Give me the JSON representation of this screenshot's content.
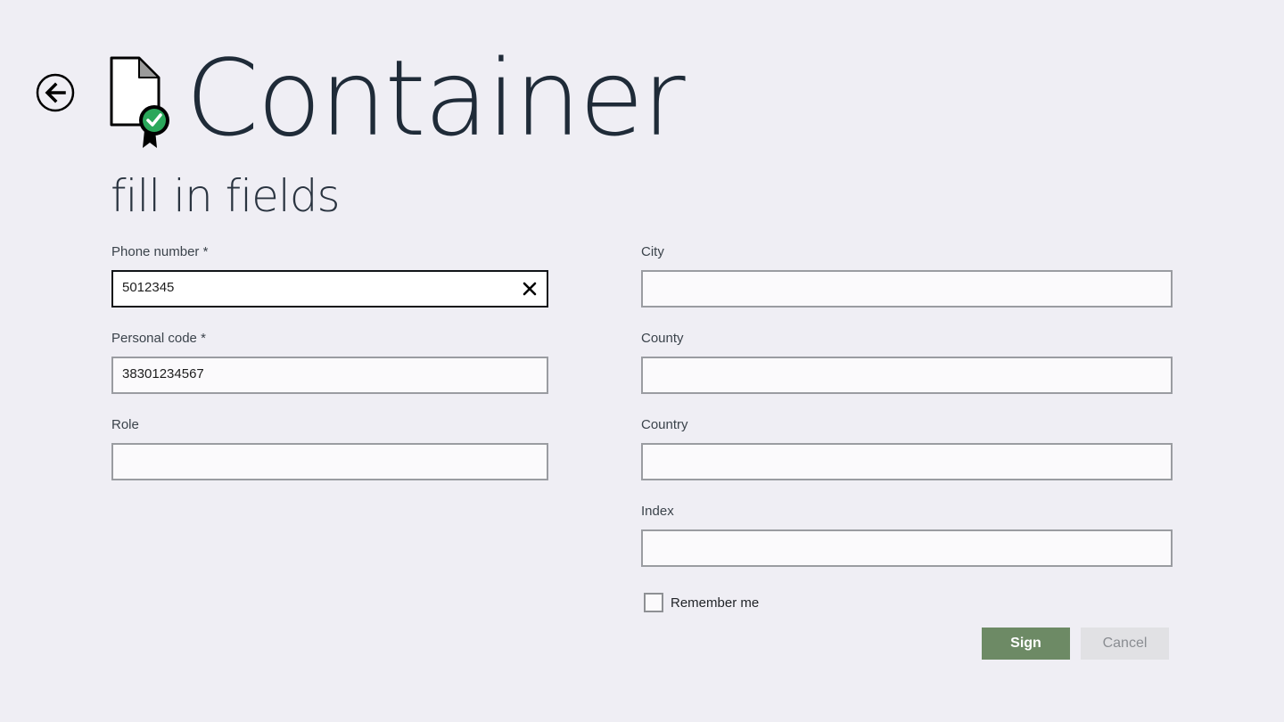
{
  "header": {
    "title": "Container",
    "subtitle": "fill in fields",
    "back_icon": "back-arrow-icon",
    "document_icon": "signed-document-icon"
  },
  "form": {
    "phone": {
      "label": "Phone number *",
      "value": "5012345"
    },
    "personal_code": {
      "label": "Personal code *",
      "value": "38301234567"
    },
    "role": {
      "label": "Role",
      "value": ""
    },
    "city": {
      "label": "City",
      "value": ""
    },
    "county": {
      "label": "County",
      "value": ""
    },
    "country": {
      "label": "Country",
      "value": ""
    },
    "index": {
      "label": "Index",
      "value": ""
    },
    "remember_me": {
      "label": "Remember me",
      "checked": false
    }
  },
  "actions": {
    "sign_label": "Sign",
    "cancel_label": "Cancel"
  },
  "colors": {
    "background": "#efeef4",
    "sign_button": "#6d8a65",
    "cancel_button": "#e1e1e4",
    "badge_green": "#2aa75a"
  }
}
